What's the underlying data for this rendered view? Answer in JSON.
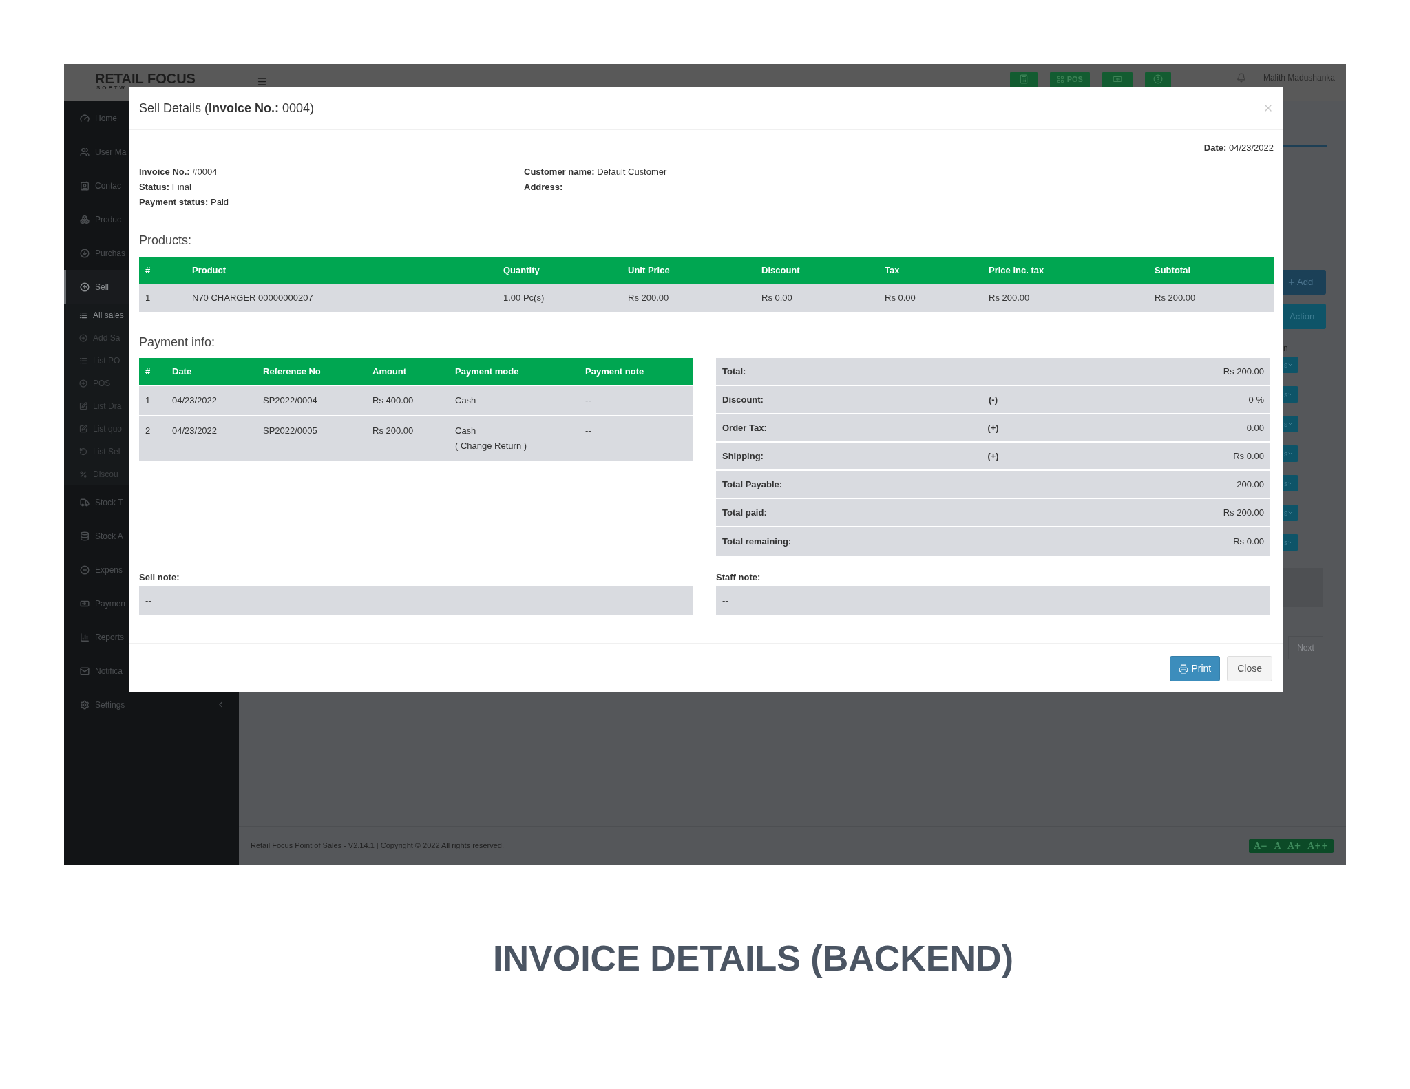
{
  "topbar": {
    "logo": "RETAIL FOCUS",
    "logo_sub": "SOFTW",
    "pos_label": "POS",
    "user": "Malith Madushanka"
  },
  "sidebar": {
    "items": [
      {
        "label": "Home",
        "selected": false
      },
      {
        "label": "User Ma",
        "selected": false
      },
      {
        "label": "Contac",
        "selected": false
      },
      {
        "label": "Produc",
        "selected": false
      },
      {
        "label": "Purchas",
        "selected": false
      },
      {
        "label": "Sell",
        "selected": true,
        "expanded": true,
        "children": [
          {
            "label": "All sales",
            "selected": true
          },
          {
            "label": "Add Sa",
            "selected": false
          },
          {
            "label": "List PO",
            "selected": false
          },
          {
            "label": "POS",
            "selected": false
          },
          {
            "label": "List Dra",
            "selected": false
          },
          {
            "label": "List quo",
            "selected": false
          },
          {
            "label": "List Sel",
            "selected": false
          },
          {
            "label": "Discou",
            "selected": false
          }
        ]
      },
      {
        "label": "Stock T",
        "selected": false
      },
      {
        "label": "Stock A",
        "selected": false
      },
      {
        "label": "Expens",
        "selected": false
      },
      {
        "label": "Paymen",
        "selected": false
      },
      {
        "label": "Reports",
        "selected": false
      },
      {
        "label": "Notifica",
        "selected": false
      },
      {
        "label": "Settings",
        "selected": false,
        "expanded": false
      }
    ]
  },
  "background": {
    "add_button": "Add",
    "action_button": "Action",
    "column_letter": "n",
    "row_buttons": [
      "s",
      "s",
      "s",
      "s",
      "s",
      "s",
      "s"
    ],
    "next_button": "Next"
  },
  "modal": {
    "title": "Sell Details (**Invoice No.:** 0004)",
    "date": {
      "label": "Date:",
      "value": "04/23/2022"
    },
    "info_left": [
      {
        "label": "Invoice No.:",
        "value": "#0004"
      },
      {
        "label": "Status:",
        "value": "Final"
      },
      {
        "label": "Payment status:",
        "value": "Paid"
      }
    ],
    "info_right": [
      {
        "label": "Customer name:",
        "value": "Default Customer"
      },
      {
        "label": "Address:"
      }
    ],
    "products": {
      "heading": "Products:",
      "columns": [
        "#",
        "Product",
        "Quantity",
        "Unit Price",
        "Discount",
        "Tax",
        "Price inc. tax",
        "Subtotal"
      ],
      "rows": [
        [
          "1",
          "N70 CHARGER 00000000207",
          "1.00 Pc(s)",
          "Rs 200.00",
          "Rs 0.00",
          "Rs 0.00",
          "Rs 200.00",
          "Rs 200.00"
        ]
      ]
    },
    "payments": {
      "heading": "Payment info:",
      "columns": [
        "#",
        "Date",
        "Reference No",
        "Amount",
        "Payment mode",
        "Payment note"
      ],
      "rows": [
        {
          "cells": [
            "1",
            "04/23/2022",
            "SP2022/0004",
            "Rs 400.00",
            "Cash",
            "--"
          ]
        },
        {
          "cells": [
            "2",
            "04/23/2022",
            "SP2022/0005",
            "Rs 200.00",
            "Cash",
            "--"
          ],
          "mode_note": "( Change Return )"
        }
      ]
    },
    "summary": [
      {
        "label": "Total:",
        "value": "Rs 200.00"
      },
      {
        "label": "Discount:",
        "sign": "(-)",
        "value": "0 %"
      },
      {
        "label": "Order Tax:",
        "sign": "(+)",
        "value": "0.00"
      },
      {
        "label": "Shipping:",
        "sign": "(+)",
        "value": "Rs 0.00"
      },
      {
        "label": "Total Payable:",
        "value": "200.00"
      },
      {
        "label": "Total paid:",
        "value": "Rs 200.00"
      },
      {
        "label": "Total remaining:",
        "value": "Rs 0.00"
      }
    ],
    "sell_note": {
      "label": "Sell note:",
      "value": "--"
    },
    "staff_note": {
      "label": "Staff note:",
      "value": "--"
    },
    "print_button": "Print",
    "close_button": "Close"
  },
  "footer": {
    "copyright": "Retail Focus Point of Sales - V2.14.1 | Copyright © 2022 All rights reserved.",
    "font_buttons": [
      "A−",
      "A",
      "A+",
      "A++"
    ]
  },
  "caption": "INVOICE DETAILS (BACKEND)"
}
